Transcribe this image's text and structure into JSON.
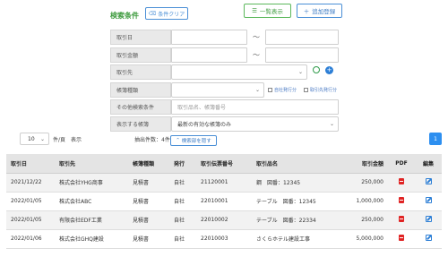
{
  "header": {
    "search_title": "検索条件",
    "clear_label": "条件クリア",
    "list_label": "一覧表示",
    "add_label": "追加登録"
  },
  "form": {
    "date_label": "取引日",
    "amount_label": "取引金額",
    "partner_label": "取引先",
    "doc_type_label": "帳簿種類",
    "other_label": "その他検索条件",
    "other_placeholder": "取引品名、帳簿番号",
    "display_label": "表示する帳簿",
    "display_value": "最新の有効な帳簿のみ",
    "tilde": "～",
    "chk_own": "自社発行分",
    "chk_partner": "取引先発行分"
  },
  "controls": {
    "per_page_value": "10",
    "per_page_suffix": "件/頁　表示",
    "count_label": "抽出件数：4件",
    "hide_label": "検索部を隠す",
    "page_number": "1"
  },
  "table": {
    "headers": [
      "取引日",
      "取引先",
      "帳簿種類",
      "発行",
      "取引伝票番号",
      "取引品名",
      "取引金額",
      "PDF",
      "編集"
    ],
    "rows": [
      [
        "2021/12/22",
        "株式会社YHG商事",
        "見積書",
        "自社",
        "21120001",
        "鋼　図番：12345",
        "250,000"
      ],
      [
        "2022/01/05",
        "株式会社ABC",
        "見積書",
        "自社",
        "22010001",
        "テーブル　図番：12345",
        "1,000,000"
      ],
      [
        "2022/01/05",
        "有限会社EDF工業",
        "見積書",
        "自社",
        "22010002",
        "テーブル　図番：22334",
        "250,000"
      ],
      [
        "2022/01/06",
        "株式会社GHQ建設",
        "見積書",
        "自社",
        "22010003",
        "さくらホテル建設工事",
        "5,000,000"
      ]
    ]
  },
  "colors": {
    "accent_blue": "#2d8ff0",
    "title_green": "#3c9a3c",
    "pdf_red": "#e02424"
  }
}
